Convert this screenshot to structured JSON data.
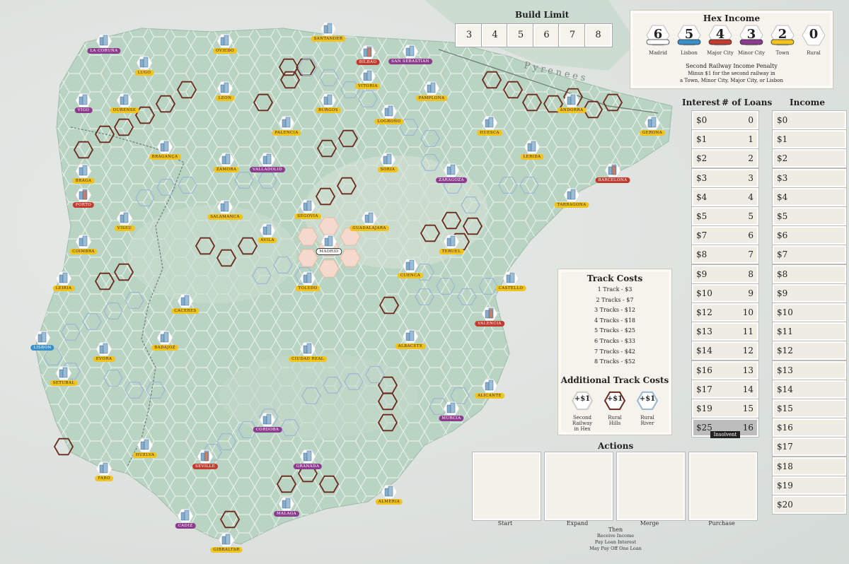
{
  "build_limit": {
    "title": "Build Limit",
    "values": [
      "3",
      "4",
      "5",
      "6",
      "7",
      "8"
    ]
  },
  "hex_income": {
    "title": "Hex Income",
    "items": [
      {
        "value": "6",
        "label": "Madrid",
        "color": "#ffffff"
      },
      {
        "value": "5",
        "label": "Lisbon",
        "color": "#3a8fc7"
      },
      {
        "value": "4",
        "label": "Major City",
        "color": "#c13b2e"
      },
      {
        "value": "3",
        "label": "Minor City",
        "color": "#8d3b8e"
      },
      {
        "value": "2",
        "label": "Town",
        "color": "#f3c31d"
      },
      {
        "value": "0",
        "label": "Rural",
        "color": "#ffffff"
      }
    ],
    "penalty_title": "Second Railway Income Penalty",
    "penalty_line1": "Minus $1 for the second railway in",
    "penalty_line2": "a Town, Minor City, Major City, or Lisbon"
  },
  "loans": {
    "interest_header": "Interest",
    "loans_header": "# of Loans",
    "rows": [
      {
        "interest": "$0",
        "loans": "0"
      },
      {
        "interest": "$1",
        "loans": "1"
      },
      {
        "interest": "$2",
        "loans": "2"
      },
      {
        "interest": "$3",
        "loans": "3"
      },
      {
        "interest": "$4",
        "loans": "4"
      },
      {
        "interest": "$5",
        "loans": "5"
      },
      {
        "interest": "$7",
        "loans": "6"
      },
      {
        "interest": "$8",
        "loans": "7"
      },
      {
        "interest": "$9",
        "loans": "8"
      },
      {
        "interest": "$10",
        "loans": "9"
      },
      {
        "interest": "$12",
        "loans": "10"
      },
      {
        "interest": "$13",
        "loans": "11"
      },
      {
        "interest": "$14",
        "loans": "12"
      },
      {
        "interest": "$16",
        "loans": "13"
      },
      {
        "interest": "$17",
        "loans": "14"
      },
      {
        "interest": "$19",
        "loans": "15"
      },
      {
        "interest": "$25",
        "loans": "16"
      }
    ],
    "insolvent_label": "Insolvent"
  },
  "income": {
    "header": "Income",
    "values": [
      "$0",
      "$1",
      "$2",
      "$3",
      "$4",
      "$5",
      "$6",
      "$7",
      "$8",
      "$9",
      "$10",
      "$11",
      "$12",
      "$13",
      "$14",
      "$15",
      "$16",
      "$17",
      "$18",
      "$19",
      "$20"
    ]
  },
  "track_costs": {
    "title": "Track Costs",
    "items": [
      "1 Track - $3",
      "2 Tracks - $7",
      "3 Tracks - $12",
      "4 Tracks - $18",
      "5 Tracks - $25",
      "6 Tracks - $33",
      "7 Tracks - $42",
      "8 Tracks - $52"
    ],
    "additional_title": "Additional Track Costs",
    "additional": [
      {
        "value": "+$1",
        "label_lines": [
          "Second",
          "Railway",
          "in Hex"
        ],
        "color": "#cccccc"
      },
      {
        "value": "+$1",
        "label_lines": [
          "Rural",
          "Hills"
        ],
        "color": "#6b2a1d"
      },
      {
        "value": "+$1",
        "label_lines": [
          "Rural",
          "River"
        ],
        "color": "#9ab6d4"
      }
    ]
  },
  "actions": {
    "title": "Actions",
    "items": [
      "Start",
      "Expand",
      "Merge",
      "Purchase"
    ],
    "then_lines": [
      "Then",
      "Receive Income",
      "Pay Loan Interest",
      "May Pay Off One Loan"
    ]
  },
  "map": {
    "region_label": "Pyrenees",
    "cities": [
      {
        "name": "LA CORUÑA",
        "type": "minor"
      },
      {
        "name": "LUGO",
        "type": "town"
      },
      {
        "name": "OVIEDO",
        "type": "town"
      },
      {
        "name": "SANTANDER",
        "type": "town"
      },
      {
        "name": "BILBAO",
        "type": "major"
      },
      {
        "name": "SAN SEBASTIAN",
        "type": "minor"
      },
      {
        "name": "VITORIA",
        "type": "town"
      },
      {
        "name": "PAMPLONA",
        "type": "town"
      },
      {
        "name": "VIGO",
        "type": "minor"
      },
      {
        "name": "OURENSE",
        "type": "town"
      },
      {
        "name": "LEON",
        "type": "town"
      },
      {
        "name": "BURGOS",
        "type": "town"
      },
      {
        "name": "LOGROÑO",
        "type": "town"
      },
      {
        "name": "ANDORRA",
        "type": "town"
      },
      {
        "name": "GERONA",
        "type": "town"
      },
      {
        "name": "PALENCIA",
        "type": "town"
      },
      {
        "name": "HUESCA",
        "type": "town"
      },
      {
        "name": "LERIDA",
        "type": "town"
      },
      {
        "name": "BRAGANÇA",
        "type": "town"
      },
      {
        "name": "ZAMORA",
        "type": "town"
      },
      {
        "name": "VALLADOLID",
        "type": "minor"
      },
      {
        "name": "SORIA",
        "type": "town"
      },
      {
        "name": "ZARAGOZA",
        "type": "minor"
      },
      {
        "name": "BARCELONA",
        "type": "major"
      },
      {
        "name": "BRAGA",
        "type": "town"
      },
      {
        "name": "PORTO",
        "type": "major"
      },
      {
        "name": "TARRAGONA",
        "type": "town"
      },
      {
        "name": "VISEU",
        "type": "town"
      },
      {
        "name": "SALAMANCA",
        "type": "town"
      },
      {
        "name": "SEGOVIA",
        "type": "town"
      },
      {
        "name": "GUADALAJARA",
        "type": "town"
      },
      {
        "name": "AVILA",
        "type": "town"
      },
      {
        "name": "MADRID",
        "type": "madrid"
      },
      {
        "name": "TERUEL",
        "type": "town"
      },
      {
        "name": "COIMBRA",
        "type": "town"
      },
      {
        "name": "CUENCA",
        "type": "town"
      },
      {
        "name": "CASTELLO",
        "type": "town"
      },
      {
        "name": "LEIRIA",
        "type": "town"
      },
      {
        "name": "TOLEDO",
        "type": "town"
      },
      {
        "name": "CACERES",
        "type": "town"
      },
      {
        "name": "VALENCIA",
        "type": "major"
      },
      {
        "name": "LISBON",
        "type": "lisbon"
      },
      {
        "name": "BADAJOZ",
        "type": "town"
      },
      {
        "name": "EVORA",
        "type": "town"
      },
      {
        "name": "CIUDAD REAL",
        "type": "town"
      },
      {
        "name": "ALBACETE",
        "type": "town"
      },
      {
        "name": "SETUBAL",
        "type": "town"
      },
      {
        "name": "ALICANTE",
        "type": "town"
      },
      {
        "name": "MURCIA",
        "type": "minor"
      },
      {
        "name": "CORDOBA",
        "type": "minor"
      },
      {
        "name": "HUELVA",
        "type": "town"
      },
      {
        "name": "SEVILLE",
        "type": "major"
      },
      {
        "name": "GRANADA",
        "type": "minor"
      },
      {
        "name": "FARO",
        "type": "town"
      },
      {
        "name": "ALMERIA",
        "type": "town"
      },
      {
        "name": "CADIZ",
        "type": "minor"
      },
      {
        "name": "MALAGA",
        "type": "minor"
      },
      {
        "name": "GIBRALTAR",
        "type": "town"
      }
    ]
  }
}
